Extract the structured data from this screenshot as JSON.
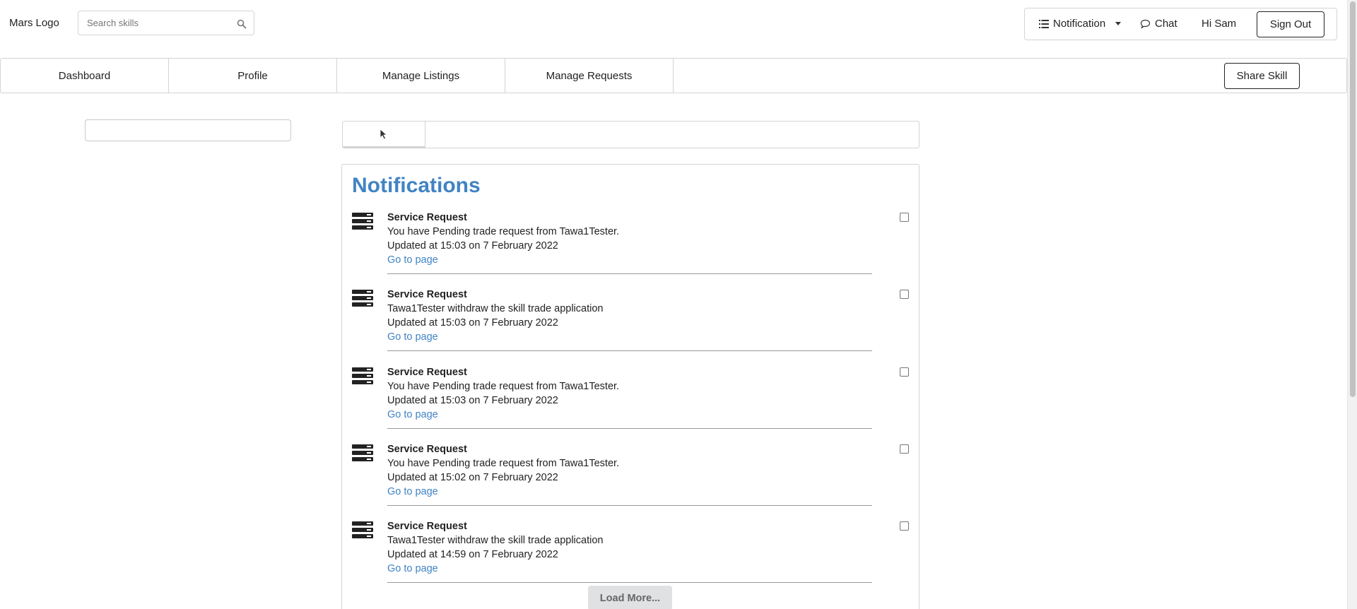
{
  "header": {
    "logo": "Mars Logo",
    "search_placeholder": "Search skills",
    "notification_label": "Notification",
    "chat_label": "Chat",
    "greeting": "Hi Sam",
    "sign_out_label": "Sign Out"
  },
  "tabs": [
    {
      "label": "Dashboard"
    },
    {
      "label": "Profile"
    },
    {
      "label": "Manage Listings"
    },
    {
      "label": "Manage Requests"
    }
  ],
  "share_skill_label": "Share Skill",
  "panel": {
    "title": "Notifications",
    "load_more_label": "Load More..."
  },
  "notifications": [
    {
      "title": "Service Request",
      "message": "You have Pending trade request from Tawa1Tester.",
      "updated": "Updated at 15:03 on 7 February 2022",
      "link": "Go to page"
    },
    {
      "title": "Service Request",
      "message": "Tawa1Tester withdraw the skill trade application",
      "updated": "Updated at 15:03 on 7 February 2022",
      "link": "Go to page"
    },
    {
      "title": "Service Request",
      "message": "You have Pending trade request from Tawa1Tester.",
      "updated": "Updated at 15:03 on 7 February 2022",
      "link": "Go to page"
    },
    {
      "title": "Service Request",
      "message": "You have Pending trade request from Tawa1Tester.",
      "updated": "Updated at 15:02 on 7 February 2022",
      "link": "Go to page"
    },
    {
      "title": "Service Request",
      "message": "Tawa1Tester withdraw the skill trade application",
      "updated": "Updated at 14:59 on 7 February 2022",
      "link": "Go to page"
    }
  ],
  "colors": {
    "accent": "#4183c4",
    "border": "#d4d4d5",
    "button_gray": "#e0e1e2"
  },
  "icons": {
    "search": "search-icon",
    "notification": "list-icon",
    "chat": "chat-bubble-icon",
    "notification_item": "server-icon",
    "pointer": "mouse-pointer-icon"
  }
}
